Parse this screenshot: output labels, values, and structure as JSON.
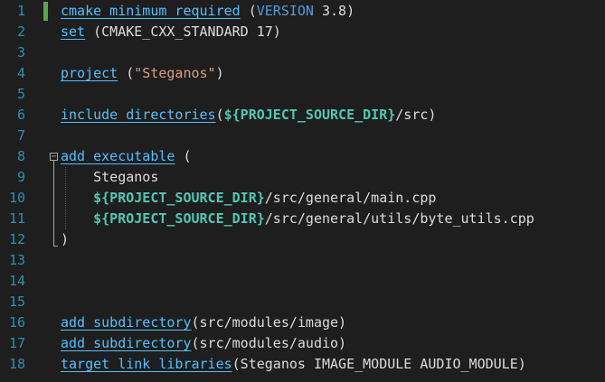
{
  "editor": {
    "colors": {
      "background": "#1e1e1e",
      "line_number": "#2b91af",
      "command": "#4fc1ff",
      "variable": "#4ec9b0",
      "keyword": "#569cd6",
      "string": "#d69d85",
      "plain": "#dcdcdc",
      "change_marker": "#57a64a"
    },
    "lines": [
      {
        "num": "1",
        "tokens": [
          {
            "t": "cmake_minimum_required",
            "k": "cmd"
          },
          {
            "t": " (",
            "k": "plain"
          },
          {
            "t": "VERSION",
            "k": "kw"
          },
          {
            "t": " 3.8)",
            "k": "plain"
          }
        ]
      },
      {
        "num": "2",
        "tokens": [
          {
            "t": "set",
            "k": "plainu"
          },
          {
            "t": " (CMAKE_CXX_STANDARD 17)",
            "k": "plain"
          }
        ]
      },
      {
        "num": "3",
        "tokens": []
      },
      {
        "num": "4",
        "tokens": [
          {
            "t": "project",
            "k": "cmd"
          },
          {
            "t": " (",
            "k": "plain"
          },
          {
            "t": "\"Steganos\"",
            "k": "str"
          },
          {
            "t": ")",
            "k": "plain"
          }
        ]
      },
      {
        "num": "5",
        "tokens": []
      },
      {
        "num": "6",
        "tokens": [
          {
            "t": "include_directories",
            "k": "cmd"
          },
          {
            "t": "(",
            "k": "plain"
          },
          {
            "t": "${PROJECT_SOURCE_DIR}",
            "k": "var"
          },
          {
            "t": "/src)",
            "k": "plain"
          }
        ]
      },
      {
        "num": "7",
        "tokens": []
      },
      {
        "num": "8",
        "tokens": [
          {
            "t": "add_executable",
            "k": "cmd"
          },
          {
            "t": " (",
            "k": "plain"
          }
        ]
      },
      {
        "num": "9",
        "tokens": [
          {
            "t": "    Steganos",
            "k": "plain"
          }
        ]
      },
      {
        "num": "10",
        "tokens": [
          {
            "t": "    ",
            "k": "plain"
          },
          {
            "t": "${PROJECT_SOURCE_DIR}",
            "k": "var"
          },
          {
            "t": "/src/general/main.cpp",
            "k": "plain"
          }
        ]
      },
      {
        "num": "11",
        "tokens": [
          {
            "t": "    ",
            "k": "plain"
          },
          {
            "t": "${PROJECT_SOURCE_DIR}",
            "k": "var"
          },
          {
            "t": "/src/general/utils/byte_utils.cpp",
            "k": "plain"
          }
        ]
      },
      {
        "num": "12",
        "tokens": [
          {
            "t": ")",
            "k": "plain"
          }
        ]
      },
      {
        "num": "13",
        "tokens": []
      },
      {
        "num": "14",
        "tokens": []
      },
      {
        "num": "15",
        "tokens": []
      },
      {
        "num": "16",
        "tokens": [
          {
            "t": "add_subdirectory",
            "k": "cmd"
          },
          {
            "t": "(src/modules/image)",
            "k": "plain"
          }
        ]
      },
      {
        "num": "17",
        "tokens": [
          {
            "t": "add_subdirectory",
            "k": "cmd"
          },
          {
            "t": "(src/modules/audio)",
            "k": "plain"
          }
        ]
      },
      {
        "num": "18",
        "tokens": [
          {
            "t": "target_link_libraries",
            "k": "cmd"
          },
          {
            "t": "(Steganos IMAGE_MODULE AUDIO_MODULE)",
            "k": "plain"
          }
        ]
      }
    ]
  }
}
